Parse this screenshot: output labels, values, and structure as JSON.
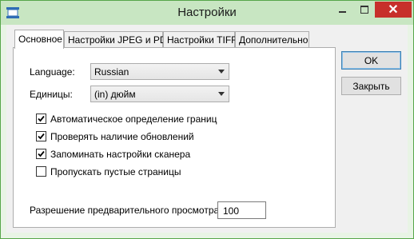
{
  "window": {
    "title": "Настройки",
    "close_glyph": "✕"
  },
  "tabs": [
    {
      "label": "Основное",
      "active": true
    },
    {
      "label": "Настройки JPEG и PDF"
    },
    {
      "label": "Настройки TIFF"
    },
    {
      "label": "Дополнительно"
    }
  ],
  "general": {
    "language_label": "Language:",
    "language_value": "Russian",
    "units_label": "Единицы:",
    "units_value": "(in) дюйм",
    "checkboxes": [
      {
        "label": "Автоматическое определение границ",
        "checked": true
      },
      {
        "label": "Проверять наличие обновлений",
        "checked": true
      },
      {
        "label": "Запоминать настройки сканера",
        "checked": true
      },
      {
        "label": "Пропускать пустые страницы",
        "checked": false
      }
    ],
    "preview_resolution_label": "Разрешение предварительного просмотра:",
    "preview_resolution_value": "100"
  },
  "buttons": {
    "ok": "OK",
    "close": "Закрыть"
  },
  "colors": {
    "border": "#57a64a",
    "titlebar": "#c8e6c2",
    "close_button": "#c7302b"
  }
}
